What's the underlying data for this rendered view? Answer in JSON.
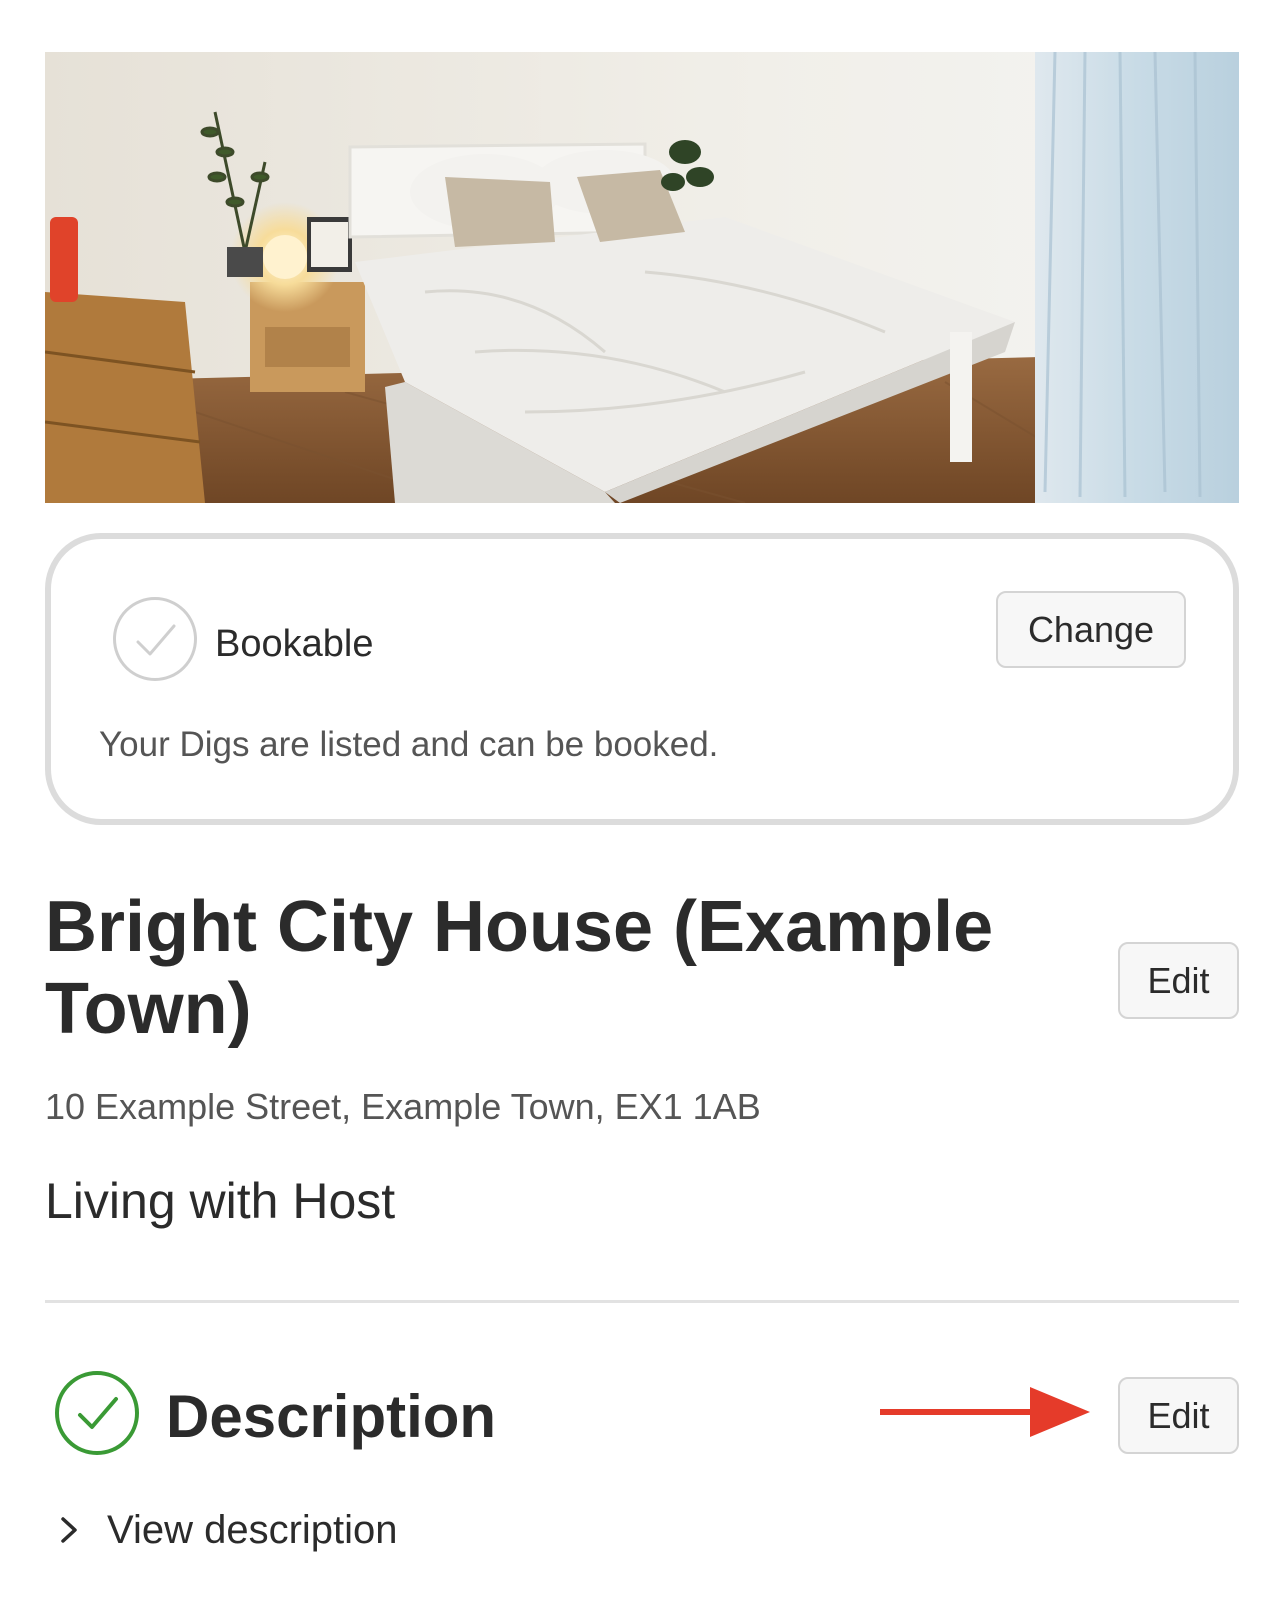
{
  "hero": {
    "image_alt": "Bedroom with white bed"
  },
  "status": {
    "label": "Bookable",
    "description": "Your Digs are listed and can be booked.",
    "change_label": "Change"
  },
  "listing": {
    "title": "Bright City House (Example Town)",
    "edit_label": "Edit",
    "address": "10 Example Street, Example Town, EX1 1AB",
    "living_type": "Living with Host"
  },
  "description": {
    "heading": "Description",
    "edit_label": "Edit",
    "view_label": "View description",
    "complete_color": "#3a9a35"
  },
  "annotation": {
    "arrow_color": "#e53b2a"
  }
}
